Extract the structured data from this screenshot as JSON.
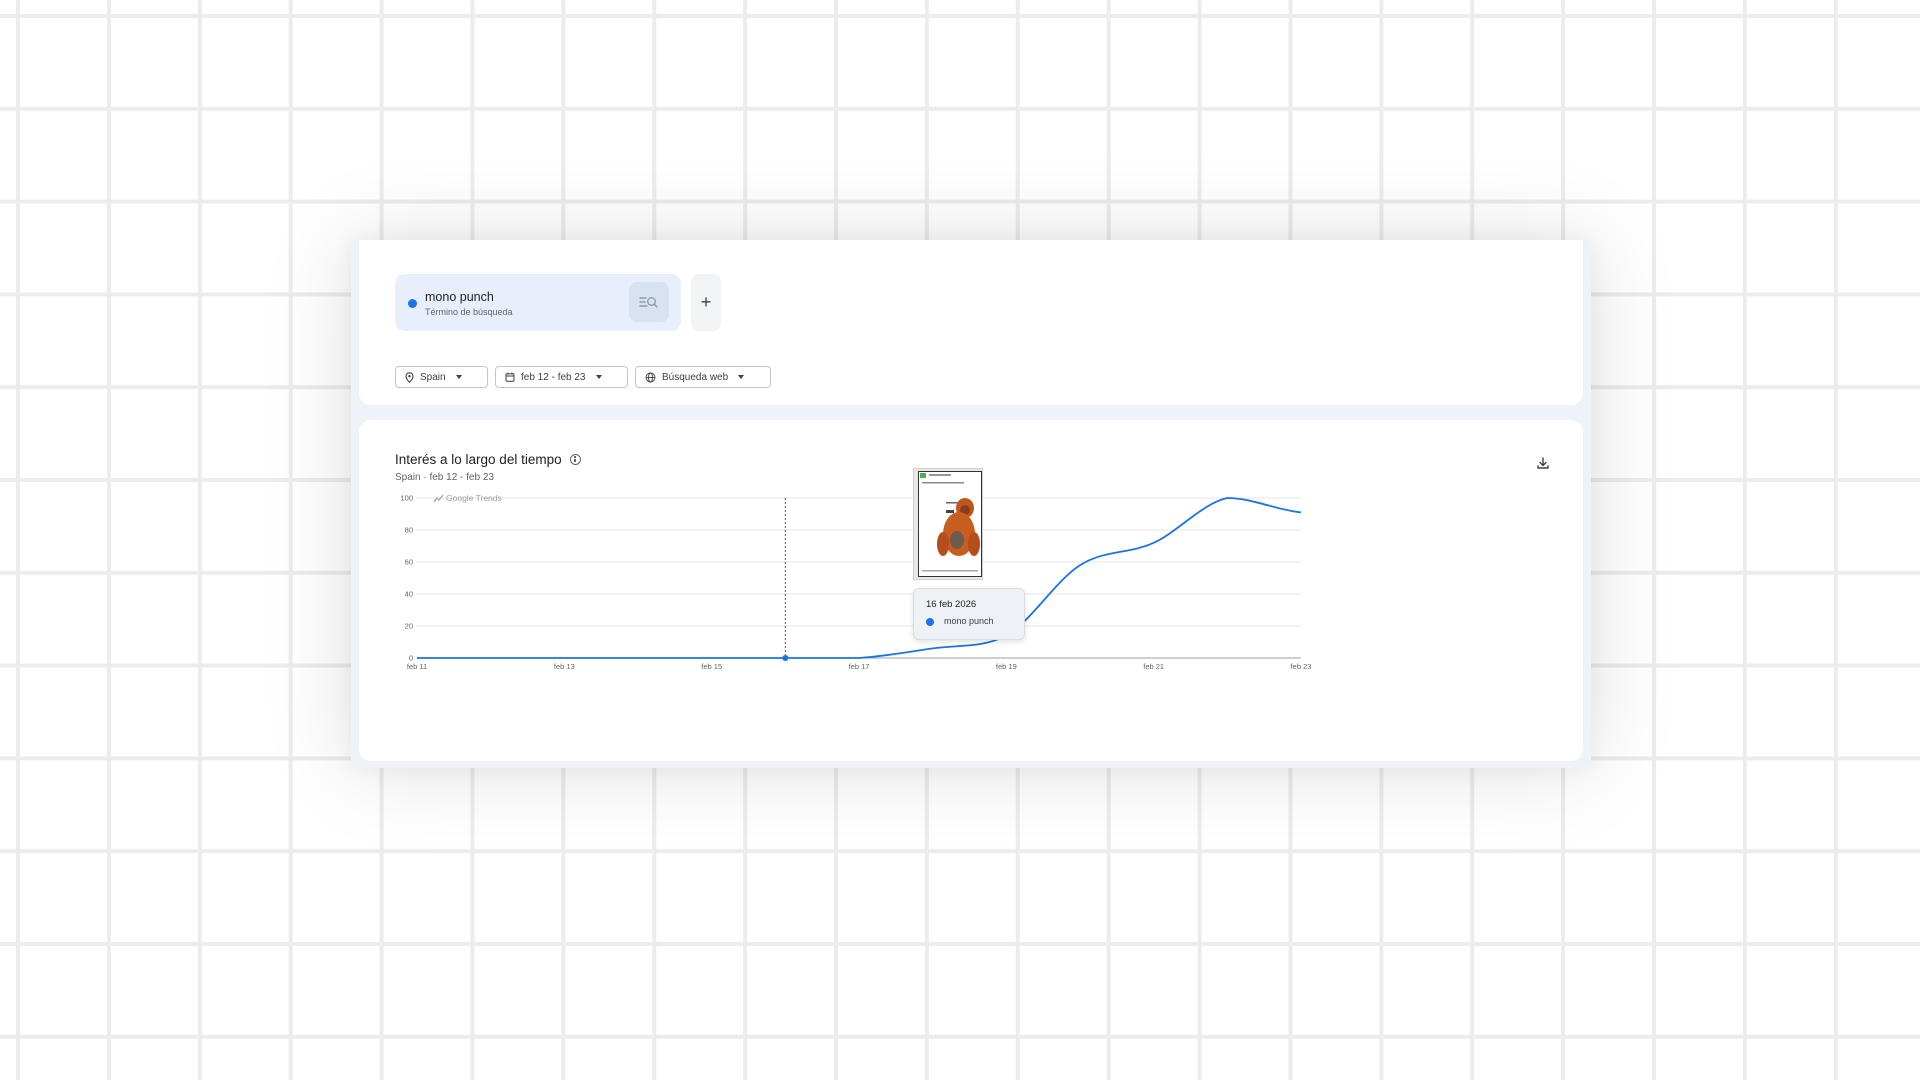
{
  "search": {
    "term": "mono punch",
    "term_type": "Término de búsqueda",
    "add_label": "+",
    "series_color": "#1a73e8"
  },
  "filters": {
    "region": "Spain",
    "date_range": "feb 12 - feb 23",
    "property": "Búsqueda web"
  },
  "chart_panel": {
    "title": "Interés a lo largo del tiempo",
    "subtitle_region": "Spain",
    "subtitle_range": "feb 12 - feb 23",
    "watermark": "Google Trends"
  },
  "tooltip": {
    "date": "16 feb 2026",
    "series": "mono punch"
  },
  "chart_data": {
    "type": "line",
    "x": [
      "feb 11",
      "feb 12",
      "feb 13",
      "feb 14",
      "feb 15",
      "feb 16",
      "feb 17",
      "feb 18",
      "feb 19",
      "feb 20",
      "feb 21",
      "feb 22",
      "feb 23"
    ],
    "x_ticks": [
      "feb 11",
      "feb 13",
      "feb 15",
      "feb 17",
      "feb 19",
      "feb 21",
      "feb 23"
    ],
    "series": [
      {
        "name": "mono punch",
        "color": "#1a73e8",
        "values": [
          0,
          0,
          0,
          0,
          0,
          0,
          0,
          6,
          14,
          58,
          72,
          100,
          91
        ]
      }
    ],
    "y_ticks": [
      0,
      20,
      40,
      60,
      80,
      100
    ],
    "ylim": [
      0,
      100
    ],
    "highlight": "feb 16",
    "grid": true
  }
}
